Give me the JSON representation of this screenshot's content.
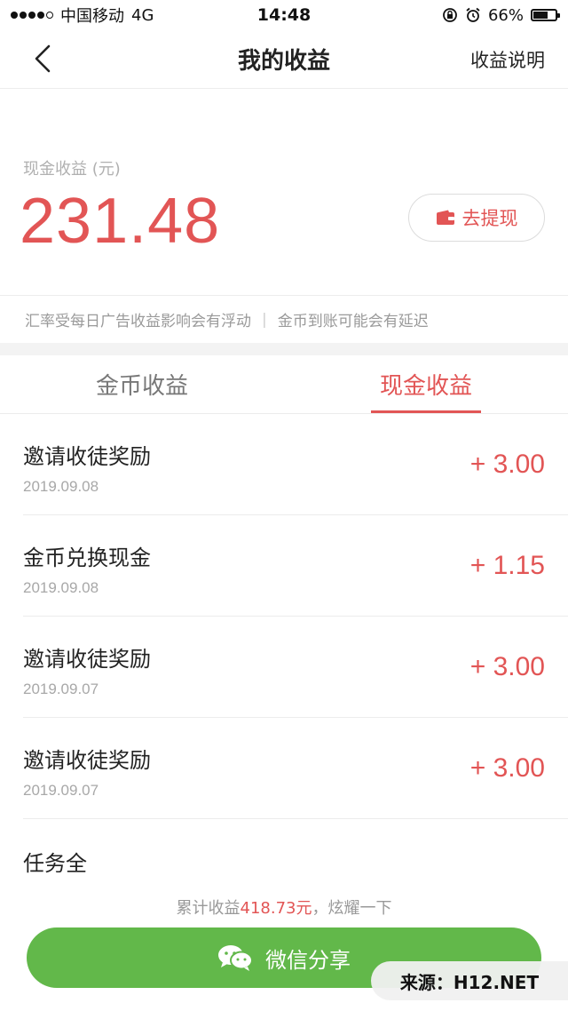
{
  "status_bar": {
    "carrier": "中国移动",
    "network": "4G",
    "time": "14:48",
    "battery": "66%",
    "battery_level": 0.66
  },
  "nav": {
    "title": "我的收益",
    "right_link": "收益说明"
  },
  "earnings": {
    "label": "现金收益 (元)",
    "amount": "231.48",
    "withdraw_label": "去提现"
  },
  "notice": {
    "left": "汇率受每日广告收益影响会有浮动",
    "separator": "|",
    "right": "金币到账可能会有延迟"
  },
  "tabs": [
    {
      "label": "金币收益",
      "active": false
    },
    {
      "label": "现金收益",
      "active": true
    }
  ],
  "records": [
    {
      "title": "邀请收徒奖励",
      "date": "2019.09.08",
      "amount": "+ 3.00"
    },
    {
      "title": "金币兑换现金",
      "date": "2019.09.08",
      "amount": "+ 1.15"
    },
    {
      "title": "邀请收徒奖励",
      "date": "2019.09.07",
      "amount": "+ 3.00"
    },
    {
      "title": "邀请收徒奖励",
      "date": "2019.09.07",
      "amount": "+ 3.00"
    },
    {
      "title": "任务全",
      "date": "",
      "amount": ""
    }
  ],
  "footer": {
    "total_prefix": "累计收益",
    "total_amount": "418.73元",
    "total_suffix": "，炫耀一下",
    "share_label": "微信分享"
  },
  "watermark": "来源：H12.NET",
  "colors": {
    "accent": "#e25555",
    "share_green": "#62b84a"
  }
}
